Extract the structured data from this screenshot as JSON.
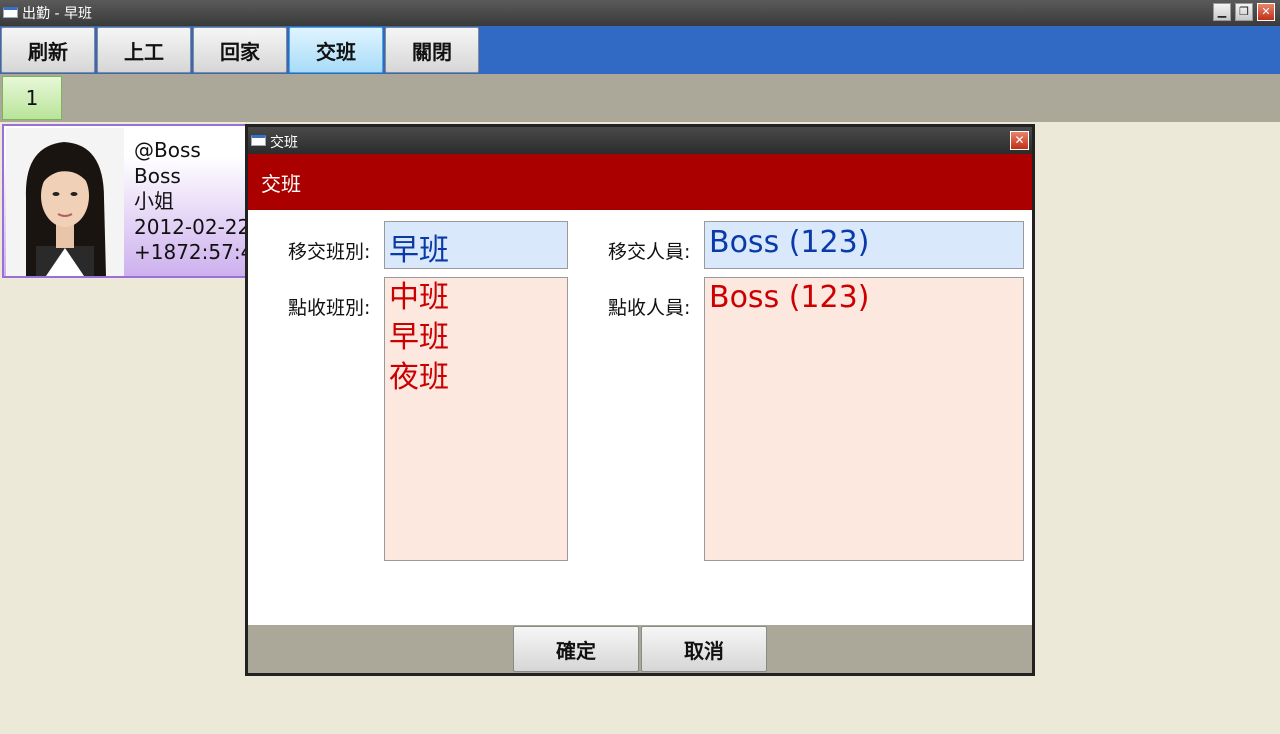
{
  "window": {
    "title": "出勤 - 早班"
  },
  "toolbar": {
    "refresh": "刷新",
    "clock_in": "上工",
    "go_home": "回家",
    "shift_change": "交班",
    "close": "關閉"
  },
  "pages": {
    "current": "1"
  },
  "employee_card": {
    "handle": "@Boss",
    "name": "Boss",
    "title": "小姐",
    "date": "2012-02-22",
    "elapsed": "+1872:57:4"
  },
  "dialog": {
    "title": "交班",
    "header": "交班",
    "handover_shift_label": "移交班別:",
    "handover_shift_value": "早班",
    "handover_person_label": "移交人員:",
    "handover_person_value": "Boss (123)",
    "receive_shift_label": "點收班別:",
    "receive_shifts": [
      "中班",
      "早班",
      "夜班"
    ],
    "receive_person_label": "點收人員:",
    "receive_persons": [
      "Boss (123)"
    ],
    "ok_label": "確定",
    "cancel_label": "取消"
  }
}
